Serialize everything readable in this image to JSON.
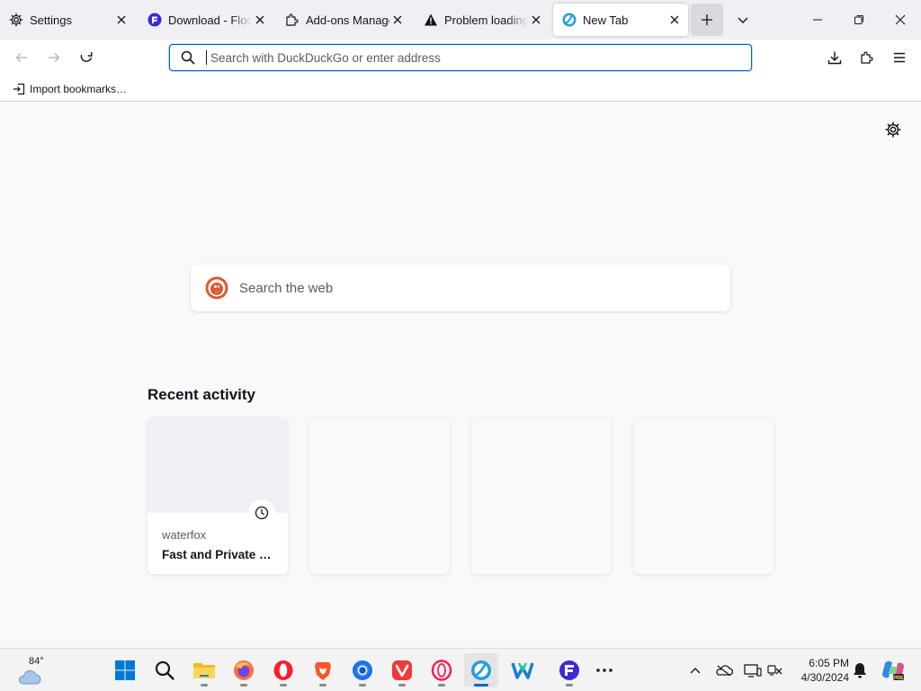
{
  "browser": {
    "tabs": [
      {
        "label": "Settings",
        "icon": "gear-icon"
      },
      {
        "label": "Download - Floorp",
        "icon": "floorp-icon"
      },
      {
        "label": "Add-ons Manager",
        "icon": "puzzle-icon"
      },
      {
        "label": "Problem loading page",
        "icon": "warning-icon"
      },
      {
        "label": "New Tab",
        "icon": "waterfox-icon",
        "active": true
      }
    ],
    "window_controls": [
      "minimize",
      "restore",
      "close"
    ],
    "urlbar": {
      "placeholder": "Search with DuckDuckGo or enter address",
      "value": ""
    },
    "bookmarks": [
      {
        "label": "Import bookmarks…",
        "icon": "import-icon"
      }
    ],
    "accent_color": "#0061e0"
  },
  "newtab": {
    "search_placeholder": "Search the web",
    "search_engine_icon": "duckduckgo-icon",
    "recent_title": "Recent activity",
    "recent_cards": [
      {
        "site": "waterfox",
        "title": "Fast and Private …",
        "badge_icon": "clock-icon"
      },
      {
        "site": "",
        "title": ""
      },
      {
        "site": "",
        "title": ""
      },
      {
        "site": "",
        "title": ""
      }
    ]
  },
  "taskbar": {
    "weather": {
      "temp": "84°",
      "icon": "cloud-weather-icon"
    },
    "apps": [
      "start-icon",
      "search-icon",
      "file-explorer-icon",
      "firefox-icon",
      "opera-icon",
      "brave-icon",
      "chrome-icon",
      "vivaldi-icon",
      "opera-gx-icon",
      "waterfox-icon",
      "wavebox-icon",
      "floorp-icon",
      "more-icon"
    ],
    "tray": [
      "chevron-up-icon",
      "onedrive-icon",
      "display-icon",
      "volume-network-icon",
      "notification-icon",
      "copilot-icon"
    ],
    "time": "6:05 PM",
    "date": "4/30/2024"
  }
}
